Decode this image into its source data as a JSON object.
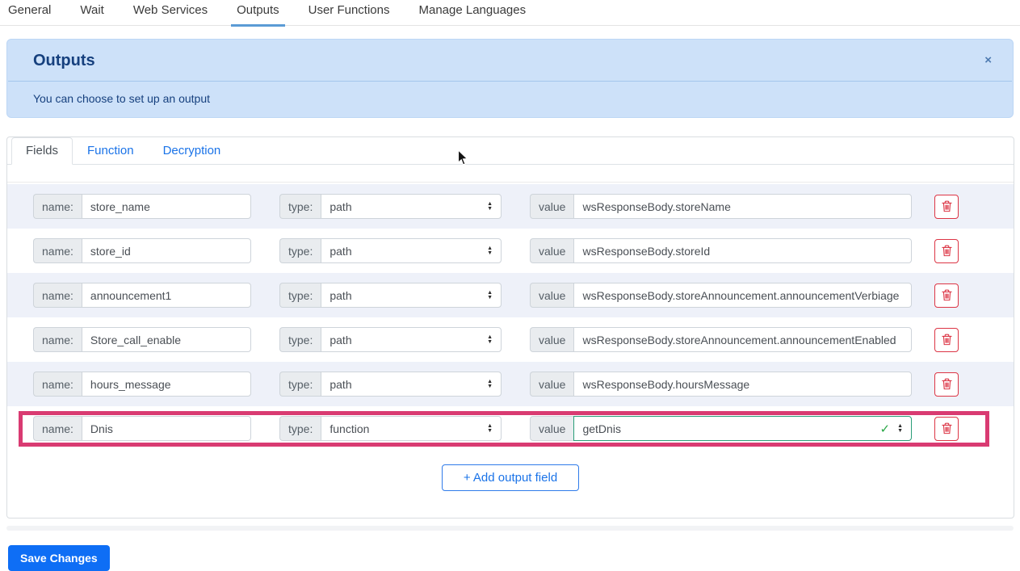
{
  "nav": {
    "tabs": [
      {
        "label": "General",
        "active": false
      },
      {
        "label": "Wait",
        "active": false
      },
      {
        "label": "Web Services",
        "active": false
      },
      {
        "label": "Outputs",
        "active": true
      },
      {
        "label": "User Functions",
        "active": false
      },
      {
        "label": "Manage Languages",
        "active": false
      }
    ]
  },
  "banner": {
    "title": "Outputs",
    "message": "You can choose to set up an output",
    "close_icon": "×"
  },
  "panel": {
    "tabs": [
      {
        "label": "Fields",
        "active": true
      },
      {
        "label": "Function",
        "active": false
      },
      {
        "label": "Decryption",
        "active": false
      }
    ],
    "field_labels": {
      "name": "name:",
      "type": "type:",
      "value": "value"
    },
    "rows": [
      {
        "name": "store_name",
        "type": "path",
        "value": "wsResponseBody.storeName",
        "value_editor": "input",
        "highlighted": false
      },
      {
        "name": "store_id",
        "type": "path",
        "value": "wsResponseBody.storeId",
        "value_editor": "input",
        "highlighted": false
      },
      {
        "name": "announcement1",
        "type": "path",
        "value": "wsResponseBody.storeAnnouncement.announcementVerbiage",
        "value_editor": "input",
        "highlighted": false
      },
      {
        "name": "Store_call_enable",
        "type": "path",
        "value": "wsResponseBody.storeAnnouncement.announcementEnabled",
        "value_editor": "input",
        "highlighted": false
      },
      {
        "name": "hours_message",
        "type": "path",
        "value": "wsResponseBody.hoursMessage",
        "value_editor": "input",
        "highlighted": false
      },
      {
        "name": "Dnis",
        "type": "function",
        "value": "getDnis",
        "value_editor": "select",
        "highlighted": true,
        "valid": true
      }
    ],
    "add_button_label": "+ Add output field"
  },
  "footer": {
    "save_button_label": "Save Changes"
  },
  "icons": {
    "check": "✓",
    "arrow_up": "▲",
    "arrow_down": "▼"
  },
  "colors": {
    "accent_blue": "#1a73e8",
    "nav_underline": "#5b9bd5",
    "banner_bg": "#cde1f9",
    "banner_text": "#16407e",
    "row_alt_bg": "#eef1f9",
    "danger_red": "#dc3545",
    "highlight_pink": "#d93b72",
    "valid_green": "#28a745",
    "save_blue": "#0e6ef5"
  }
}
